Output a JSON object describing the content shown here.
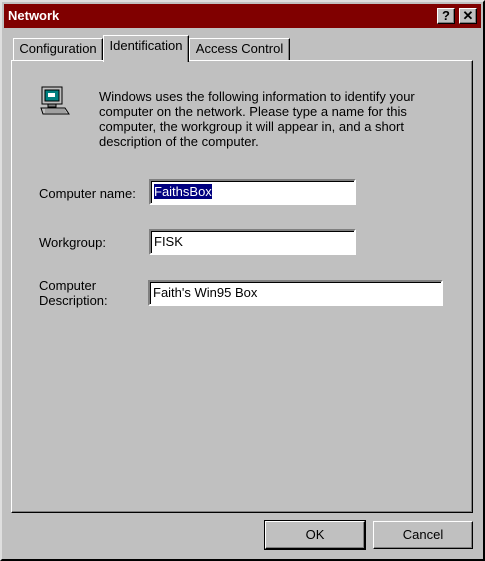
{
  "window": {
    "title": "Network",
    "help_label": "?",
    "close_label": "✕"
  },
  "tabs": [
    {
      "label": "Configuration"
    },
    {
      "label": "Identification"
    },
    {
      "label": "Access Control"
    }
  ],
  "identification": {
    "info_text": "Windows uses the following information to identify your computer on the network.  Please type a name for this computer, the workgroup it will appear in, and a short description of the computer.",
    "computer_name_label": "Computer name:",
    "computer_name_value": "FaithsBox",
    "workgroup_label": "Workgroup:",
    "workgroup_value": "FISK",
    "description_label_line1": "Computer",
    "description_label_line2": "Description:",
    "description_value": "Faith's Win95 Box"
  },
  "buttons": {
    "ok_label": "OK",
    "cancel_label": "Cancel"
  },
  "icons": {
    "computer": "computer-icon"
  },
  "colors": {
    "titlebar": "#800000",
    "face": "#c0c0c0",
    "selection": "#000080"
  }
}
